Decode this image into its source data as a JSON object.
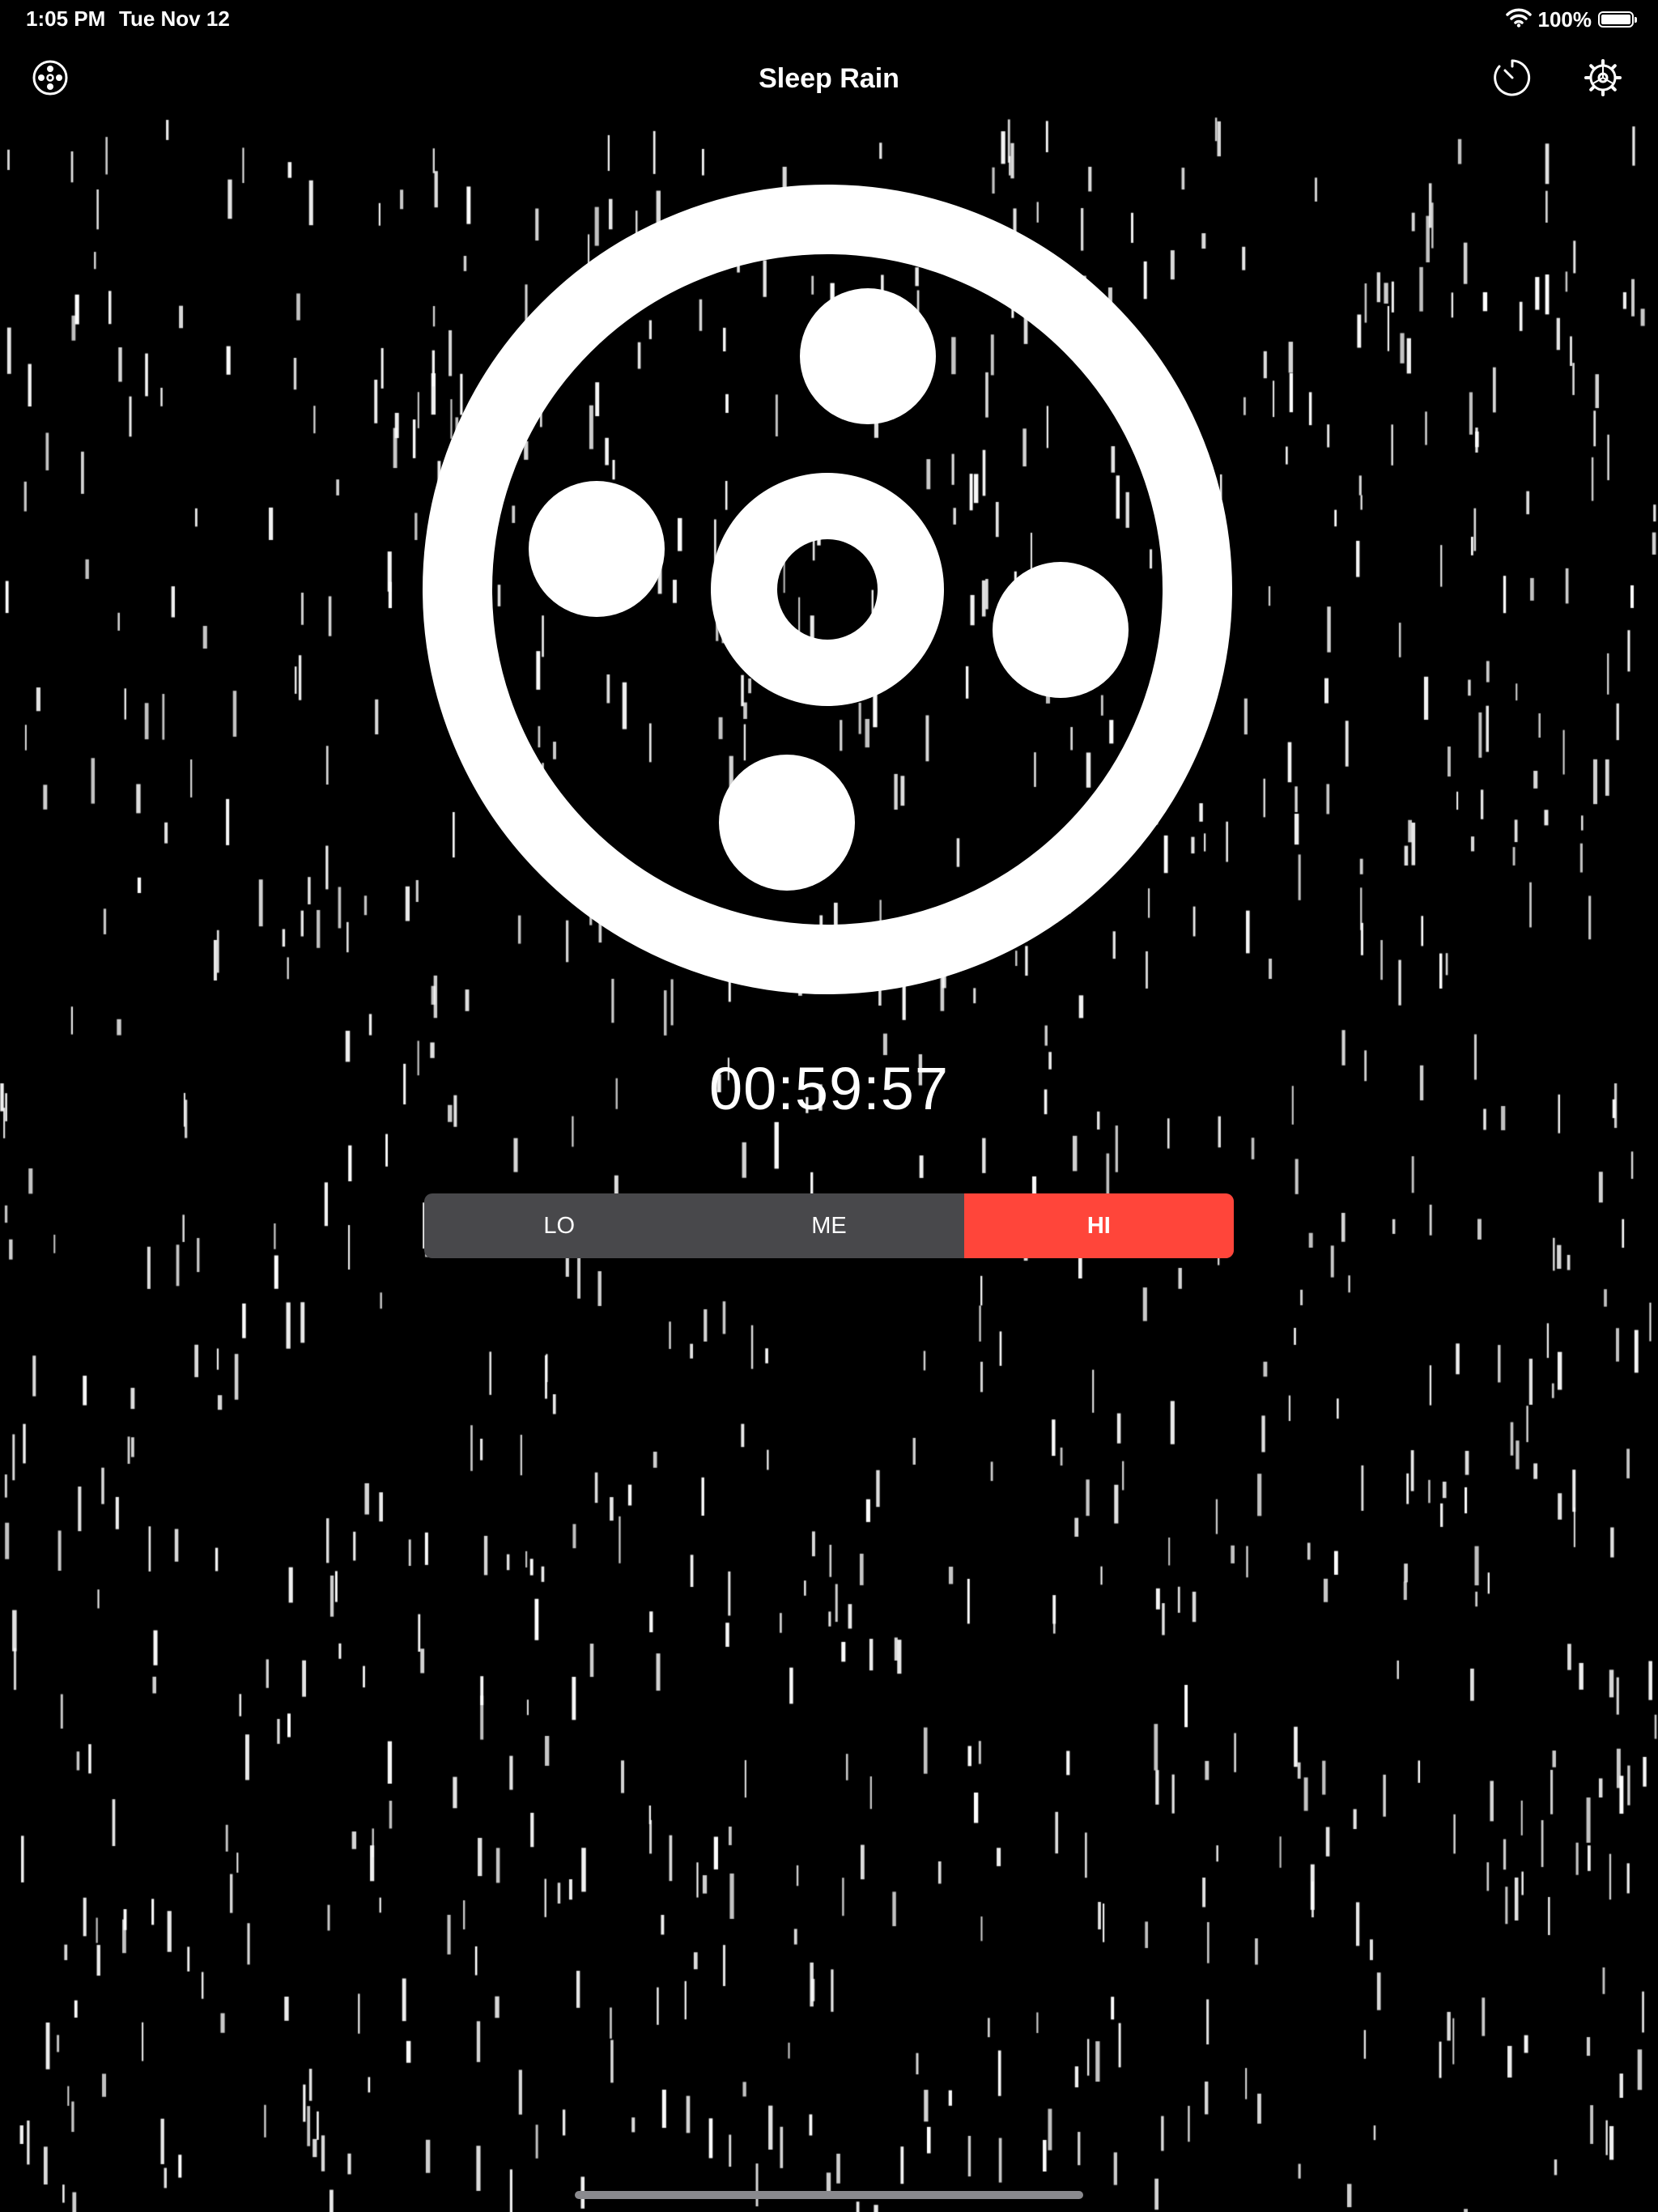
{
  "status_bar": {
    "time": "1:05 PM",
    "date": "Tue Nov 12",
    "battery_percent": "100%",
    "battery_level": 1.0,
    "wifi_icon": "wifi-icon",
    "battery_icon": "battery-icon"
  },
  "nav": {
    "title": "Sleep Rain",
    "left_icon": "mixer-icon",
    "timer_icon": "timer-icon",
    "settings_icon": "gear-icon"
  },
  "wheel": {
    "icon": "rain-wheel-icon"
  },
  "timer": {
    "remaining": "00:59:57"
  },
  "intensity": {
    "options": [
      "LO",
      "ME",
      "HI"
    ],
    "selected": "HI",
    "active_color": "#ff453a",
    "inactive_color": "#48484b"
  },
  "theme": {
    "background": "#000000",
    "foreground": "#ffffff"
  }
}
